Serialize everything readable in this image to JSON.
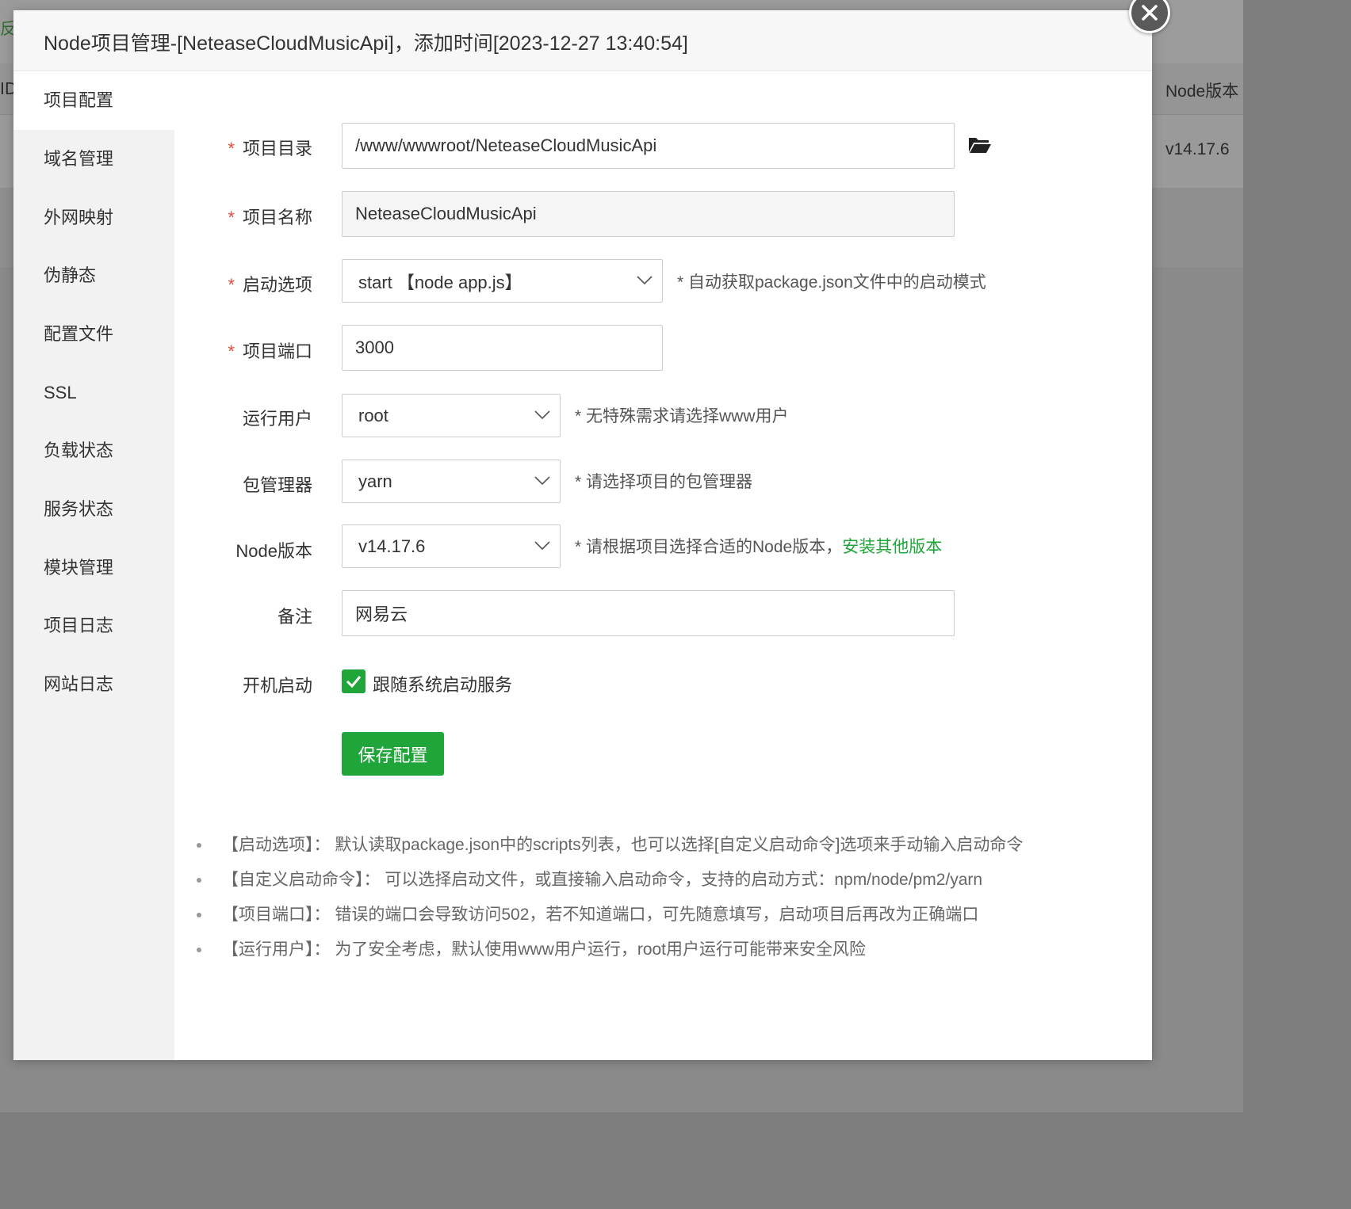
{
  "background": {
    "corner_text": "反",
    "id_header": "ID",
    "node_version_header": "Node版本",
    "node_version_value": "v14.17.6"
  },
  "modal": {
    "title": "Node项目管理-[NeteaseCloudMusicApi]，添加时间[2023-12-27 13:40:54]"
  },
  "sidebar": {
    "items": [
      {
        "label": "项目配置"
      },
      {
        "label": "域名管理"
      },
      {
        "label": "外网映射"
      },
      {
        "label": "伪静态"
      },
      {
        "label": "配置文件"
      },
      {
        "label": "SSL"
      },
      {
        "label": "负载状态"
      },
      {
        "label": "服务状态"
      },
      {
        "label": "模块管理"
      },
      {
        "label": "项目日志"
      },
      {
        "label": "网站日志"
      }
    ]
  },
  "form": {
    "required_mark": "*",
    "project_dir": {
      "label": "项目目录",
      "value": "/www/wwwroot/NeteaseCloudMusicApi",
      "icon": "folder-open-icon"
    },
    "project_name": {
      "label": "项目名称",
      "value": "NeteaseCloudMusicApi"
    },
    "start_option": {
      "label": "启动选项",
      "value": "start 【node app.js】",
      "hint": "* 自动获取package.json文件中的启动模式"
    },
    "project_port": {
      "label": "项目端口",
      "value": "3000"
    },
    "run_user": {
      "label": "运行用户",
      "value": "root",
      "hint": "* 无特殊需求请选择www用户"
    },
    "package_manager": {
      "label": "包管理器",
      "value": "yarn",
      "hint": "* 请选择项目的包管理器"
    },
    "node_version": {
      "label": "Node版本",
      "value": "v14.17.6",
      "hint": "* 请根据项目选择合适的Node版本，",
      "hint_link": "安装其他版本"
    },
    "remark": {
      "label": "备注",
      "value": "网易云"
    },
    "autostart": {
      "label": "开机启动",
      "checkbox_label": "跟随系统启动服务",
      "checked": true
    },
    "save_label": "保存配置"
  },
  "notes": [
    "【启动选项】： 默认读取package.json中的scripts列表，也可以选择[自定义启动命令]选项来手动输入启动命令",
    "【自定义启动命令】： 可以选择启动文件，或直接输入启动命令，支持的启动方式：npm/node/pm2/yarn",
    "【项目端口】： 错误的端口会导致访问502，若不知道端口，可先随意填写，启动项目后再改为正确端口",
    "【运行用户】： 为了安全考虑，默认使用www用户运行，root用户运行可能带来安全风险"
  ],
  "colors": {
    "accent": "#20a53a",
    "required": "#e84c3d",
    "overlay": "#7d7d7d"
  }
}
